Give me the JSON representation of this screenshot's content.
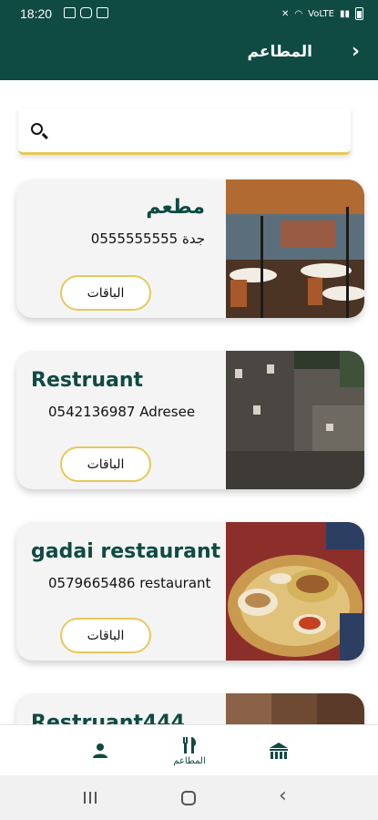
{
  "status_bar": {
    "time": "18:20",
    "network": "VoLTE"
  },
  "app_bar": {
    "title": "المطاعم",
    "back_glyph": "›"
  },
  "search": {
    "placeholder": "",
    "value": ""
  },
  "restaurants": [
    {
      "name": "مطعم",
      "subtitle": "جدة 0555555555",
      "button_label": "الباقات",
      "image": "restaurant-dining-hall-photo"
    },
    {
      "name": "Restruant",
      "subtitle": "0542136987 Adresee",
      "button_label": "الباقات",
      "image": "stone-tower-houses-photo"
    },
    {
      "name": "gadai restaurant",
      "subtitle": "0579665486 restaurant",
      "button_label": "الباقات",
      "image": "traditional-food-platter-photo"
    },
    {
      "name": "Restruant444",
      "image": "canyon-rock-photo"
    }
  ],
  "bottom_nav": {
    "profile": {
      "icon": "person-icon"
    },
    "restaurants": {
      "icon": "fork-knife-icon",
      "label": "المطاعم"
    },
    "home": {
      "icon": "heritage-building-icon"
    }
  },
  "colors": {
    "primary": "#0f4a43",
    "accent": "#e7c85a",
    "card_bg": "#f4f4f4"
  }
}
